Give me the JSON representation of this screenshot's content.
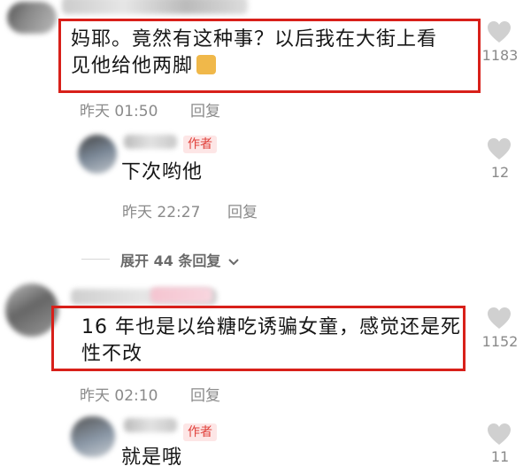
{
  "comments": [
    {
      "text_line1": "妈耶。竟然有这种事？以后我在大街上看",
      "text_line2": "见他给他两脚",
      "time": "昨天 01:50",
      "reply_label": "回复",
      "like_count": "1183",
      "emoji": "cat-emoji",
      "reply": {
        "badge": "作者",
        "text": "下次哟他",
        "time": "昨天 22:27",
        "reply_label": "回复",
        "like_count": "12"
      },
      "expand_label": "展开 44 条回复"
    },
    {
      "text_line1": "16 年也是以给糖吃诱骗女童，感觉还是死",
      "text_line2": "性不改",
      "time": "昨天 02:10",
      "reply_label": "回复",
      "like_count": "1152",
      "reply": {
        "badge": "作者",
        "text": "就是哦",
        "like_count": "11"
      }
    }
  ],
  "colors": {
    "highlight": "#d8201a",
    "badge_bg": "#fde6e6",
    "badge_text": "#e0403a",
    "meta_text": "#8a8a8a"
  }
}
